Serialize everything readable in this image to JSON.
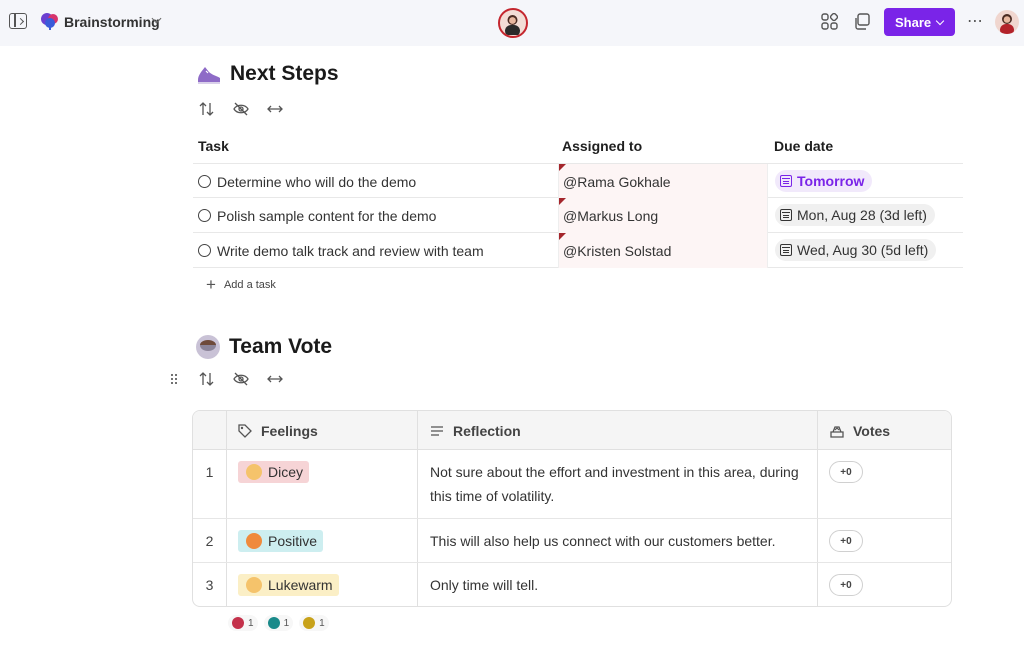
{
  "topbar": {
    "title": "Brainstorming",
    "share_label": "Share",
    "more_label": "⋯"
  },
  "next_steps": {
    "title": "Next Steps",
    "columns": [
      "Task",
      "Assigned to",
      "Due date"
    ],
    "rows": [
      {
        "task": "Determine who will do the demo",
        "assigned": "@Rama Gokhale",
        "due": "Tomorrow",
        "highlight": true
      },
      {
        "task": "Polish sample content for the demo",
        "assigned": "@Markus Long",
        "due": "Mon, Aug 28 (3d left)",
        "highlight": false
      },
      {
        "task": "Write demo talk track and review with team",
        "assigned": "@Kristen Solstad",
        "due": "Wed, Aug 30 (5d left)",
        "highlight": false
      }
    ],
    "add_task_label": "Add a task"
  },
  "team_vote": {
    "title": "Team Vote",
    "columns": [
      "Feelings",
      "Reflection",
      "Votes"
    ],
    "rows": [
      {
        "num": "1",
        "feeling": "Dicey",
        "feeling_color": "#f6d4d6",
        "reflection": "Not sure about the effort and investment in this area, during this time of volatility.",
        "votes": "+0"
      },
      {
        "num": "2",
        "feeling": "Positive",
        "feeling_color": "#cdeef0",
        "reflection": "This will also help us connect with our customers better.",
        "votes": "+0"
      },
      {
        "num": "3",
        "feeling": "Lukewarm",
        "feeling_color": "#fbefc6",
        "reflection": "Only time will tell.",
        "votes": "+0"
      }
    ],
    "reactions": [
      {
        "count": "1",
        "color": "#c4314b"
      },
      {
        "count": "1",
        "color": "#1a8a8a"
      },
      {
        "count": "1",
        "color": "#c8a21a"
      }
    ]
  },
  "colors": {
    "accent": "#7a24e8",
    "assigned_marker": "#a4262c"
  }
}
